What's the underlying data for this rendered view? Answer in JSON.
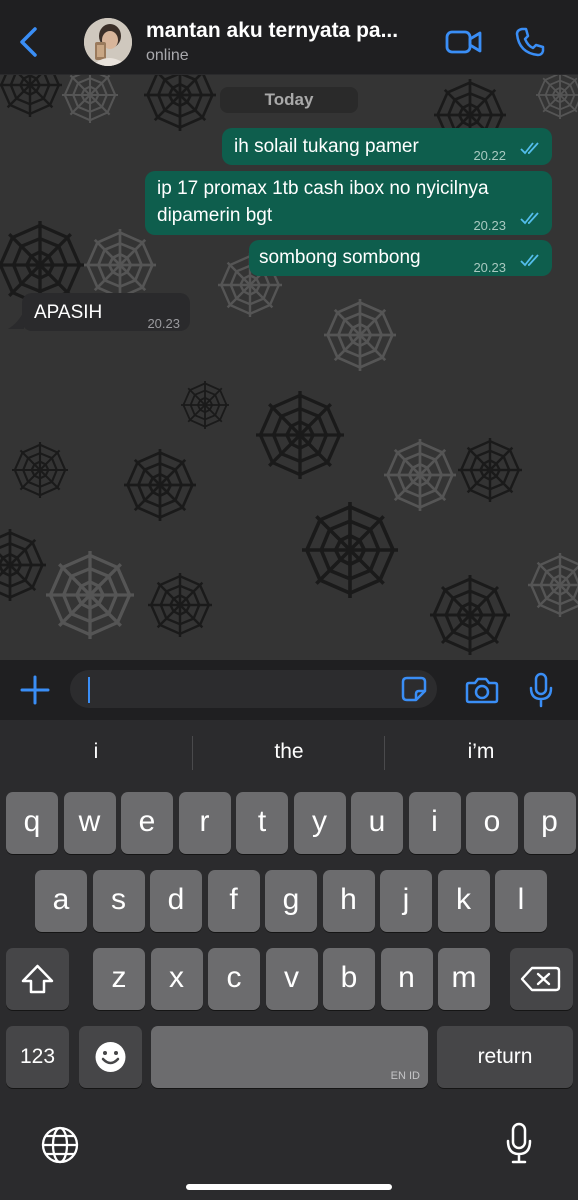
{
  "header": {
    "title": "mantan aku ternyata pa...",
    "status": "online"
  },
  "chat": {
    "date_label": "Today",
    "messages": [
      {
        "dir": "out",
        "lines": [
          "ih solail tukang pamer"
        ],
        "time": "20.22",
        "read": true
      },
      {
        "dir": "out",
        "lines": [
          "ip 17 promax 1tb cash ibox no nyicilnya",
          "dipamerin bgt"
        ],
        "time": "20.23",
        "read": true
      },
      {
        "dir": "out",
        "lines": [
          "sombong sombong"
        ],
        "time": "20.23",
        "read": true
      },
      {
        "dir": "in",
        "lines": [
          "APASIH"
        ],
        "time": "20.23"
      }
    ]
  },
  "composer": {
    "text": ""
  },
  "keyboard": {
    "suggestions": [
      "i",
      "the",
      "i’m"
    ],
    "row1": [
      "q",
      "w",
      "e",
      "r",
      "t",
      "y",
      "u",
      "i",
      "o",
      "p"
    ],
    "row2": [
      "a",
      "s",
      "d",
      "f",
      "g",
      "h",
      "j",
      "k",
      "l"
    ],
    "row3": [
      "z",
      "x",
      "c",
      "v",
      "b",
      "n",
      "m"
    ],
    "numbers_key": "123",
    "return_key": "return",
    "space_hint": "EN ID"
  },
  "colors": {
    "accent": "#3a8ef6",
    "outgoing_bubble": "#0e5e4d",
    "incoming_bubble": "#2a2a2c",
    "read_ticks": "#53bdeb"
  }
}
